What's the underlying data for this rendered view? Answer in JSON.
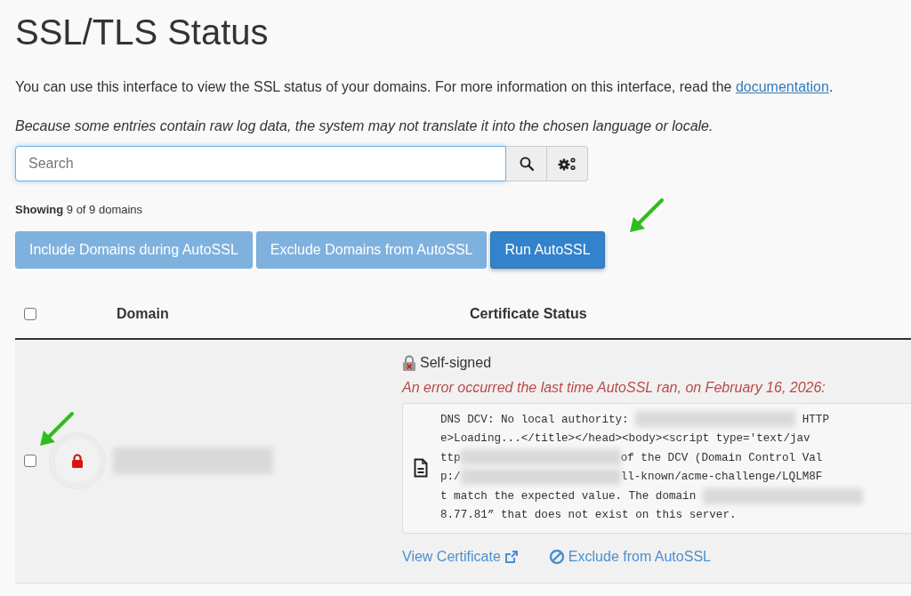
{
  "page": {
    "title": "SSL/TLS Status",
    "intro": "You can use this interface to view the SSL status of your domains. For more information on this interface, read the ",
    "intro_link": "documentation",
    "intro_end": ".",
    "note": "Because some entries contain raw log data, the system may not translate it into the chosen language or locale."
  },
  "search": {
    "placeholder": "Search"
  },
  "summary": "**Showing** 9 of 9 domains",
  "buttons": [
    {
      "label": "Include Domains during AutoSSL",
      "kind": "secondary"
    },
    {
      "label": "Exclude Domains from AutoSSL",
      "kind": "secondary"
    },
    {
      "label": "Run AutoSSL",
      "kind": "primary"
    }
  ],
  "table": {
    "select_all": {
      "checked": false
    },
    "columns": [
      "Domain",
      "Certificate Status"
    ],
    "rows": [
      {
        "checked": false,
        "certificate": "Self-signed",
        "error": "An error occurred the last time AutoSSL ran, on February 16, 2026:",
        "log_lines": [
          [
            {
              "kind": "text",
              "text": "DNS DCV: No local authority: "
            },
            {
              "kind": "redacted"
            },
            {
              "kind": "text",
              "text": " HTTP"
            }
          ],
          [
            {
              "kind": "text",
              "text": "e>Loading...</title></head><body><script type='text/jav"
            }
          ],
          [
            {
              "kind": "text",
              "text": "ttp"
            },
            {
              "kind": "redacted"
            },
            {
              "kind": "text",
              "text": "of the DCV (Domain Control Val"
            }
          ],
          [
            {
              "kind": "text",
              "text": "p:/"
            },
            {
              "kind": "redacted"
            },
            {
              "kind": "text",
              "text": "ll-known/acme-challenge/LQLM8F"
            }
          ],
          [
            {
              "kind": "text",
              "text": "t match the expected value. The domain "
            },
            {
              "kind": "redacted"
            }
          ],
          [
            {
              "kind": "text",
              "text": "8.77.81” that does not exist on this server."
            }
          ]
        ],
        "links": [
          {
            "label": "View Certificate",
            "kind": "view"
          },
          {
            "label": "Exclude from AutoSSL",
            "kind": "exclude"
          }
        ]
      }
    ]
  }
}
